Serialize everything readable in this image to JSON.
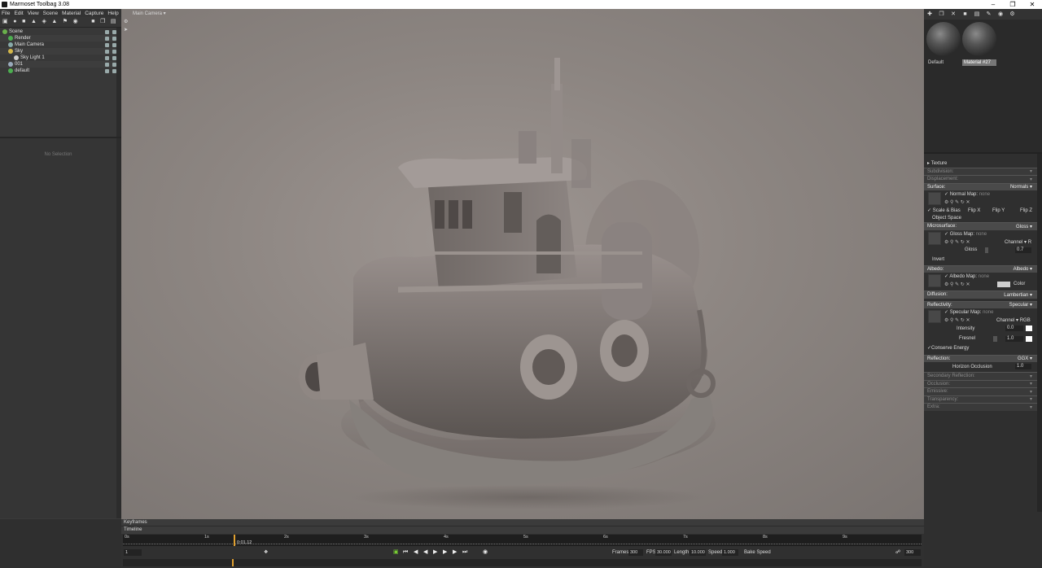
{
  "window": {
    "title": "Marmoset Toolbag 3.08"
  },
  "menu": [
    "File",
    "Edit",
    "View",
    "Scene",
    "Material",
    "Capture",
    "Help"
  ],
  "scene_tree": [
    {
      "label": "Scene",
      "indent": 0,
      "icon": "scene-icon",
      "color": "#6ab04c"
    },
    {
      "label": "Render",
      "indent": 1,
      "icon": "render-icon",
      "color": "#4caf50"
    },
    {
      "label": "Main Camera",
      "indent": 1,
      "icon": "camera-icon",
      "color": "#8aa"
    },
    {
      "label": "Sky",
      "indent": 1,
      "icon": "sky-icon",
      "color": "#d4b84a"
    },
    {
      "label": "Sky Light 1",
      "indent": 2,
      "icon": "light-icon",
      "color": "#ccc"
    },
    {
      "label": "001",
      "indent": 1,
      "icon": "mesh-icon",
      "color": "#9ab"
    },
    {
      "label": "default",
      "indent": 1,
      "icon": "material-icon",
      "color": "#4caf50"
    }
  ],
  "properties": {
    "empty_text": "No Selection"
  },
  "viewport": {
    "camera_label": "Main Camera"
  },
  "materials": [
    {
      "name": "Default",
      "selected": false
    },
    {
      "name": "Material #27",
      "selected": true
    }
  ],
  "material_props": {
    "texture": "Texture",
    "subdivision": "Subdivision:",
    "displacement": "Displacement:",
    "surface": {
      "label": "Surface:",
      "value": "Normals"
    },
    "normal_map": {
      "label": "Normal Map:",
      "value": "none"
    },
    "scale_bias": "Scale & Bias",
    "flip_x": "Flip X",
    "flip_y": "Flip Y",
    "flip_z": "Flip Z",
    "object_space": "Object Space",
    "microsurface": {
      "label": "Microsurface:",
      "value": "Gloss"
    },
    "gloss_map": {
      "label": "Gloss Map:",
      "value": "none"
    },
    "gloss_channel": {
      "label": "Channel",
      "value": "R"
    },
    "gloss": {
      "label": "Gloss",
      "value": "0.7"
    },
    "invert": "Invert",
    "albedo": {
      "label": "Albedo:",
      "value": "Albedo"
    },
    "albedo_map": {
      "label": "Albedo Map:",
      "value": "none"
    },
    "albedo_color": "Color",
    "diffusion": {
      "label": "Diffusion:",
      "value": "Lambertian"
    },
    "reflectivity": {
      "label": "Reflectivity:",
      "value": "Specular"
    },
    "specular_map": {
      "label": "Specular Map:",
      "value": "none"
    },
    "spec_channel": {
      "label": "Channel",
      "value": "RGB"
    },
    "intensity": {
      "label": "Intensity",
      "value": "0.0"
    },
    "fresnel": {
      "label": "Fresnel",
      "value": "1.0"
    },
    "conserve_energy": "Conserve Energy",
    "reflection": {
      "label": "Reflection:",
      "value": "GGX"
    },
    "horizon_occlusion": {
      "label": "Horizon Occlusion",
      "value": "1.0"
    },
    "secondary_reflection": "Secondary Reflection:",
    "occlusion": "Occlusion:",
    "emissive": "Emissive:",
    "transparency": "Transparency:",
    "extra": "Extra:"
  },
  "timeline": {
    "keyframes_label": "Keyframes",
    "timeline_label": "Timeline",
    "ticks": [
      "0s",
      "1s",
      "2s",
      "3s",
      "4s",
      "5s",
      "6s",
      "7s",
      "8s",
      "9s"
    ],
    "current_time": "0:01.12",
    "current_frame": "1",
    "frames": {
      "label": "Frames",
      "value": "300"
    },
    "fps": {
      "label": "FPS",
      "value": "30.000"
    },
    "length": {
      "label": "Length",
      "value": "10.000"
    },
    "speed": {
      "label": "Speed",
      "value": "1.000"
    },
    "bake_speed": "Bake Speed",
    "end_frame": "300"
  }
}
